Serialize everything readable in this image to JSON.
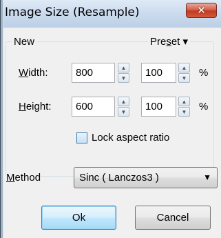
{
  "window": {
    "title": "Image Size (Resample)",
    "close_glyph": "✕"
  },
  "group": {
    "label": "New",
    "preset": {
      "label_before": "Pre",
      "label_mnemonic": "s",
      "label_after": "et",
      "arrow": "▾"
    }
  },
  "width": {
    "mnemonic": "W",
    "label_rest": "idth:",
    "pixels": "800",
    "percent": "100",
    "percent_sign": "%"
  },
  "height": {
    "mnemonic": "H",
    "label_rest": "eight:",
    "pixels": "600",
    "percent": "100",
    "percent_sign": "%"
  },
  "lock_aspect": {
    "label": "Lock aspect ratio",
    "checked": false
  },
  "method": {
    "mnemonic": "M",
    "label_rest": "ethod",
    "selected": "Sinc ( Lanczos3 )"
  },
  "buttons": {
    "ok": "Ok",
    "cancel": "Cancel"
  },
  "colors": {
    "title_bar": "#cadbee",
    "close_button": "#c03a21",
    "default_button": "#bee6fd",
    "dialog_bg": "#f0f0f0"
  },
  "icons": {
    "spin_up": "▲",
    "spin_down": "▼",
    "dropdown": "▼"
  }
}
